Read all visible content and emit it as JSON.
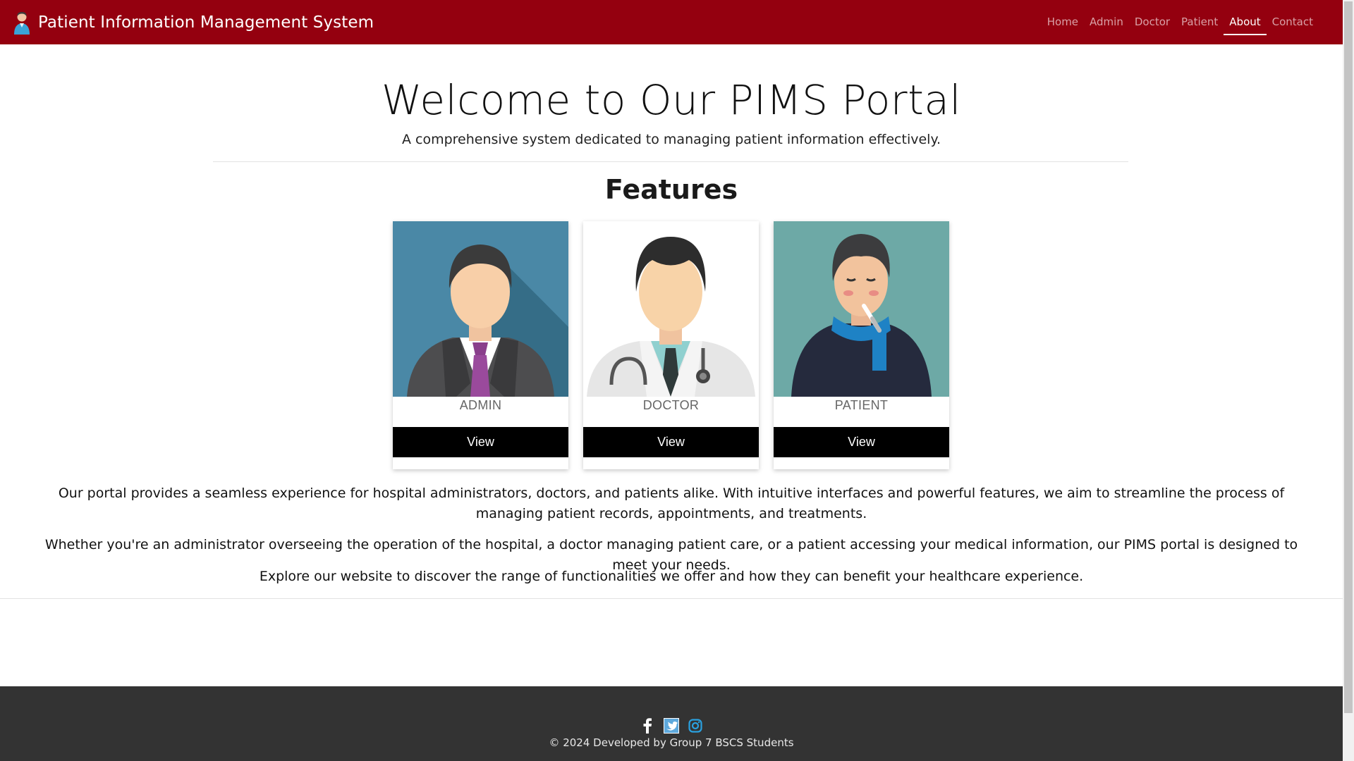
{
  "brand": {
    "title": "Patient Information Management System",
    "icon": "doctor-avatar-icon"
  },
  "nav": {
    "items": [
      {
        "label": "Home",
        "active": false
      },
      {
        "label": "Admin",
        "active": false
      },
      {
        "label": "Doctor",
        "active": false
      },
      {
        "label": "Patient",
        "active": false
      },
      {
        "label": "About",
        "active": true
      },
      {
        "label": "Contact",
        "active": false
      }
    ]
  },
  "hero": {
    "title": "Welcome to Our PIMS Portal",
    "subtitle": "A comprehensive system dedicated to managing patient information effectively."
  },
  "features": {
    "title": "Features",
    "cards": [
      {
        "label": "ADMIN",
        "button": "View",
        "image": "admin-illustration"
      },
      {
        "label": "DOCTOR",
        "button": "View",
        "image": "doctor-illustration"
      },
      {
        "label": "PATIENT",
        "button": "View",
        "image": "patient-illustration"
      }
    ]
  },
  "about": {
    "p1": "Our portal provides a seamless experience for hospital administrators, doctors, and patients alike. With intuitive interfaces and powerful features, we aim to streamline the process of managing patient records, appointments, and treatments.",
    "p2": "Whether you're an administrator overseeing the operation of the hospital, a doctor managing patient care, or a patient accessing your medical information, our PIMS portal is designed to meet your needs.",
    "p3": "Explore our website to discover the range of functionalities we offer and how they can benefit your healthcare experience."
  },
  "footer": {
    "socials": [
      "facebook-icon",
      "twitter-icon",
      "instagram-icon"
    ],
    "copyright": "© 2024 Developed by Group 7 BSCS Students"
  },
  "colors": {
    "navbar": "#94000f",
    "footer": "#333333",
    "button": "#000000"
  }
}
